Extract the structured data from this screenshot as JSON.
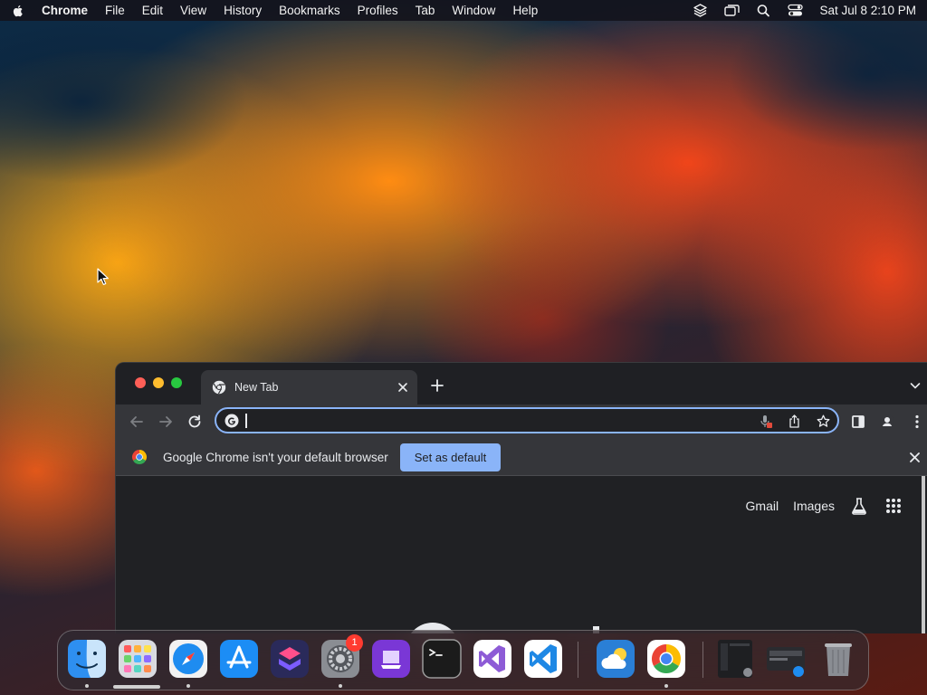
{
  "menubar": {
    "app_name": "Chrome",
    "items": [
      "File",
      "Edit",
      "View",
      "History",
      "Bookmarks",
      "Profiles",
      "Tab",
      "Window",
      "Help"
    ],
    "status_icons": [
      "layers-icon",
      "screen-mirroring-icon",
      "spotlight-search-icon",
      "control-center-icon"
    ],
    "clock": "Sat Jul 8  2:10 PM"
  },
  "browser": {
    "tab_title": "New Tab",
    "omnibox_value": "",
    "infobar_message": "Google Chrome isn't your default browser",
    "infobar_button": "Set as default",
    "ntp_links": {
      "gmail": "Gmail",
      "images": "Images"
    },
    "colors": {
      "accent": "#8ab4f8",
      "frame": "#1f2024",
      "toolbar": "#35363a"
    }
  },
  "dock": {
    "apps": [
      {
        "name": "Finder",
        "icon": "finder-icon",
        "running": true
      },
      {
        "name": "Launchpad",
        "icon": "launchpad-icon",
        "running": false
      },
      {
        "name": "Safari",
        "icon": "safari-icon",
        "running": true
      },
      {
        "name": "App Store",
        "icon": "app-store-icon",
        "running": false
      },
      {
        "name": "Shortcuts",
        "icon": "shortcuts-icon",
        "running": false
      },
      {
        "name": "System Settings",
        "icon": "system-settings-icon",
        "running": true,
        "badge": "1"
      },
      {
        "name": "Apple Configurator",
        "icon": "configurator-icon",
        "running": false
      },
      {
        "name": "Terminal",
        "icon": "terminal-icon",
        "running": false
      },
      {
        "name": "Visual Studio",
        "icon": "visual-studio-icon",
        "running": false
      },
      {
        "name": "Visual Studio Code",
        "icon": "vscode-icon",
        "running": false
      },
      {
        "name": "Weather",
        "icon": "weather-icon",
        "running": false
      },
      {
        "name": "Google Chrome",
        "icon": "chrome-icon",
        "running": true
      },
      {
        "name": "Recent window 1",
        "icon": "window-thumbnail-icon",
        "running": false
      },
      {
        "name": "Recent window 2",
        "icon": "window-thumbnail-icon",
        "running": false
      },
      {
        "name": "Trash",
        "icon": "trash-icon",
        "running": false
      }
    ]
  }
}
